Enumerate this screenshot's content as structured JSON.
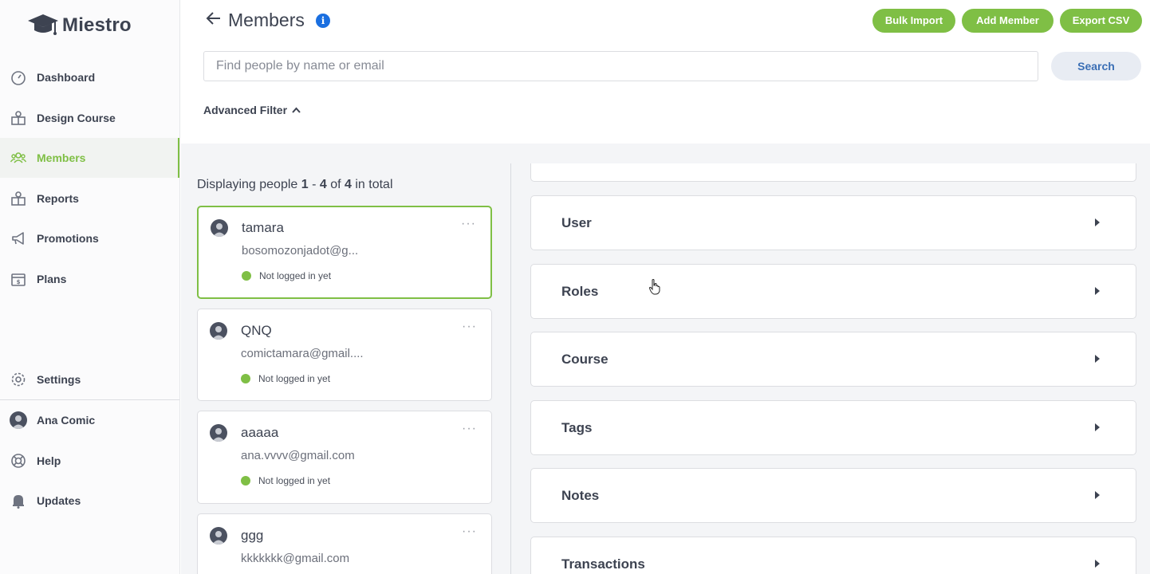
{
  "brand": {
    "name": "Miestro"
  },
  "sidebar": {
    "items": [
      {
        "label": "Dashboard",
        "icon": "dashboard-gauge-icon"
      },
      {
        "label": "Design Course",
        "icon": "design-course-icon"
      },
      {
        "label": "Members",
        "icon": "members-group-icon",
        "active": true
      },
      {
        "label": "Reports",
        "icon": "reports-icon"
      },
      {
        "label": "Promotions",
        "icon": "megaphone-icon"
      },
      {
        "label": "Plans",
        "icon": "plans-dollar-icon"
      }
    ],
    "bottom": [
      {
        "label": "Settings",
        "icon": "gear-icon"
      },
      {
        "label": "Ana Comic",
        "icon": "user-avatar-icon"
      },
      {
        "label": "Help",
        "icon": "lifebuoy-icon"
      },
      {
        "label": "Updates",
        "icon": "bell-icon"
      }
    ]
  },
  "header": {
    "title": "Members",
    "info": "i",
    "buttons": {
      "bulk_import": "Bulk Import",
      "add_member": "Add Member",
      "export_csv": "Export CSV"
    },
    "search_placeholder": "Find people by name or email",
    "search_value": "",
    "search_button": "Search",
    "advanced_filter": "Advanced Filter"
  },
  "list": {
    "display_prefix": "Displaying people ",
    "display_from": "1",
    "display_sep": " - ",
    "display_to": "4",
    "display_of": " of ",
    "display_total": "4",
    "display_suffix": " in total",
    "members": [
      {
        "name": "tamara",
        "email": "bosomozonjadot@g...",
        "status": "Not logged in yet",
        "selected": true
      },
      {
        "name": "QNQ",
        "email": "comictamara@gmail....",
        "status": "Not logged in yet"
      },
      {
        "name": "aaaaa",
        "email": "ana.vvvv@gmail.com",
        "status": "Not logged in yet"
      },
      {
        "name": "ggg",
        "email": "kkkkkkk@gmail.com",
        "status": ""
      }
    ],
    "more": "···"
  },
  "sections": {
    "items": [
      "User",
      "Roles",
      "Course",
      "Tags",
      "Notes",
      "Transactions"
    ]
  },
  "colors": {
    "accent": "#7fbf45",
    "info": "#1a6fe0",
    "text": "#3d4351"
  }
}
